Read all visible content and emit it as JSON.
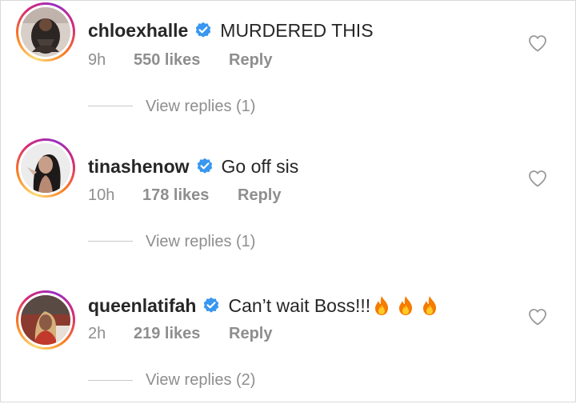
{
  "comments": [
    {
      "username": "chloexhalle",
      "text": "MURDERED THIS",
      "emoji": [],
      "time": "9h",
      "likes": "550 likes",
      "reply_label": "Reply",
      "view_replies": "View replies (1)",
      "avatar_icon": "avatar-photo"
    },
    {
      "username": "tinashenow",
      "text": "Go off sis",
      "emoji": [],
      "time": "10h",
      "likes": "178 likes",
      "reply_label": "Reply",
      "view_replies": "View replies (1)",
      "avatar_icon": "avatar-photo"
    },
    {
      "username": "queenlatifah",
      "text": "Can’t wait Boss!!!",
      "emoji": [
        "🔥",
        "🔥",
        "🔥"
      ],
      "time": "2h",
      "likes": "219 likes",
      "reply_label": "Reply",
      "view_replies": "View replies (2)",
      "avatar_icon": "avatar-photo"
    }
  ],
  "icons": {
    "verified": "verified-badge-icon",
    "like": "heart-outline-icon",
    "fire": "fire-emoji-icon"
  },
  "colors": {
    "verified_blue": "#3897f0",
    "meta_gray": "#8e8e8e",
    "text": "#262626",
    "ring_start": "#feda75",
    "ring_end": "#d62976"
  }
}
